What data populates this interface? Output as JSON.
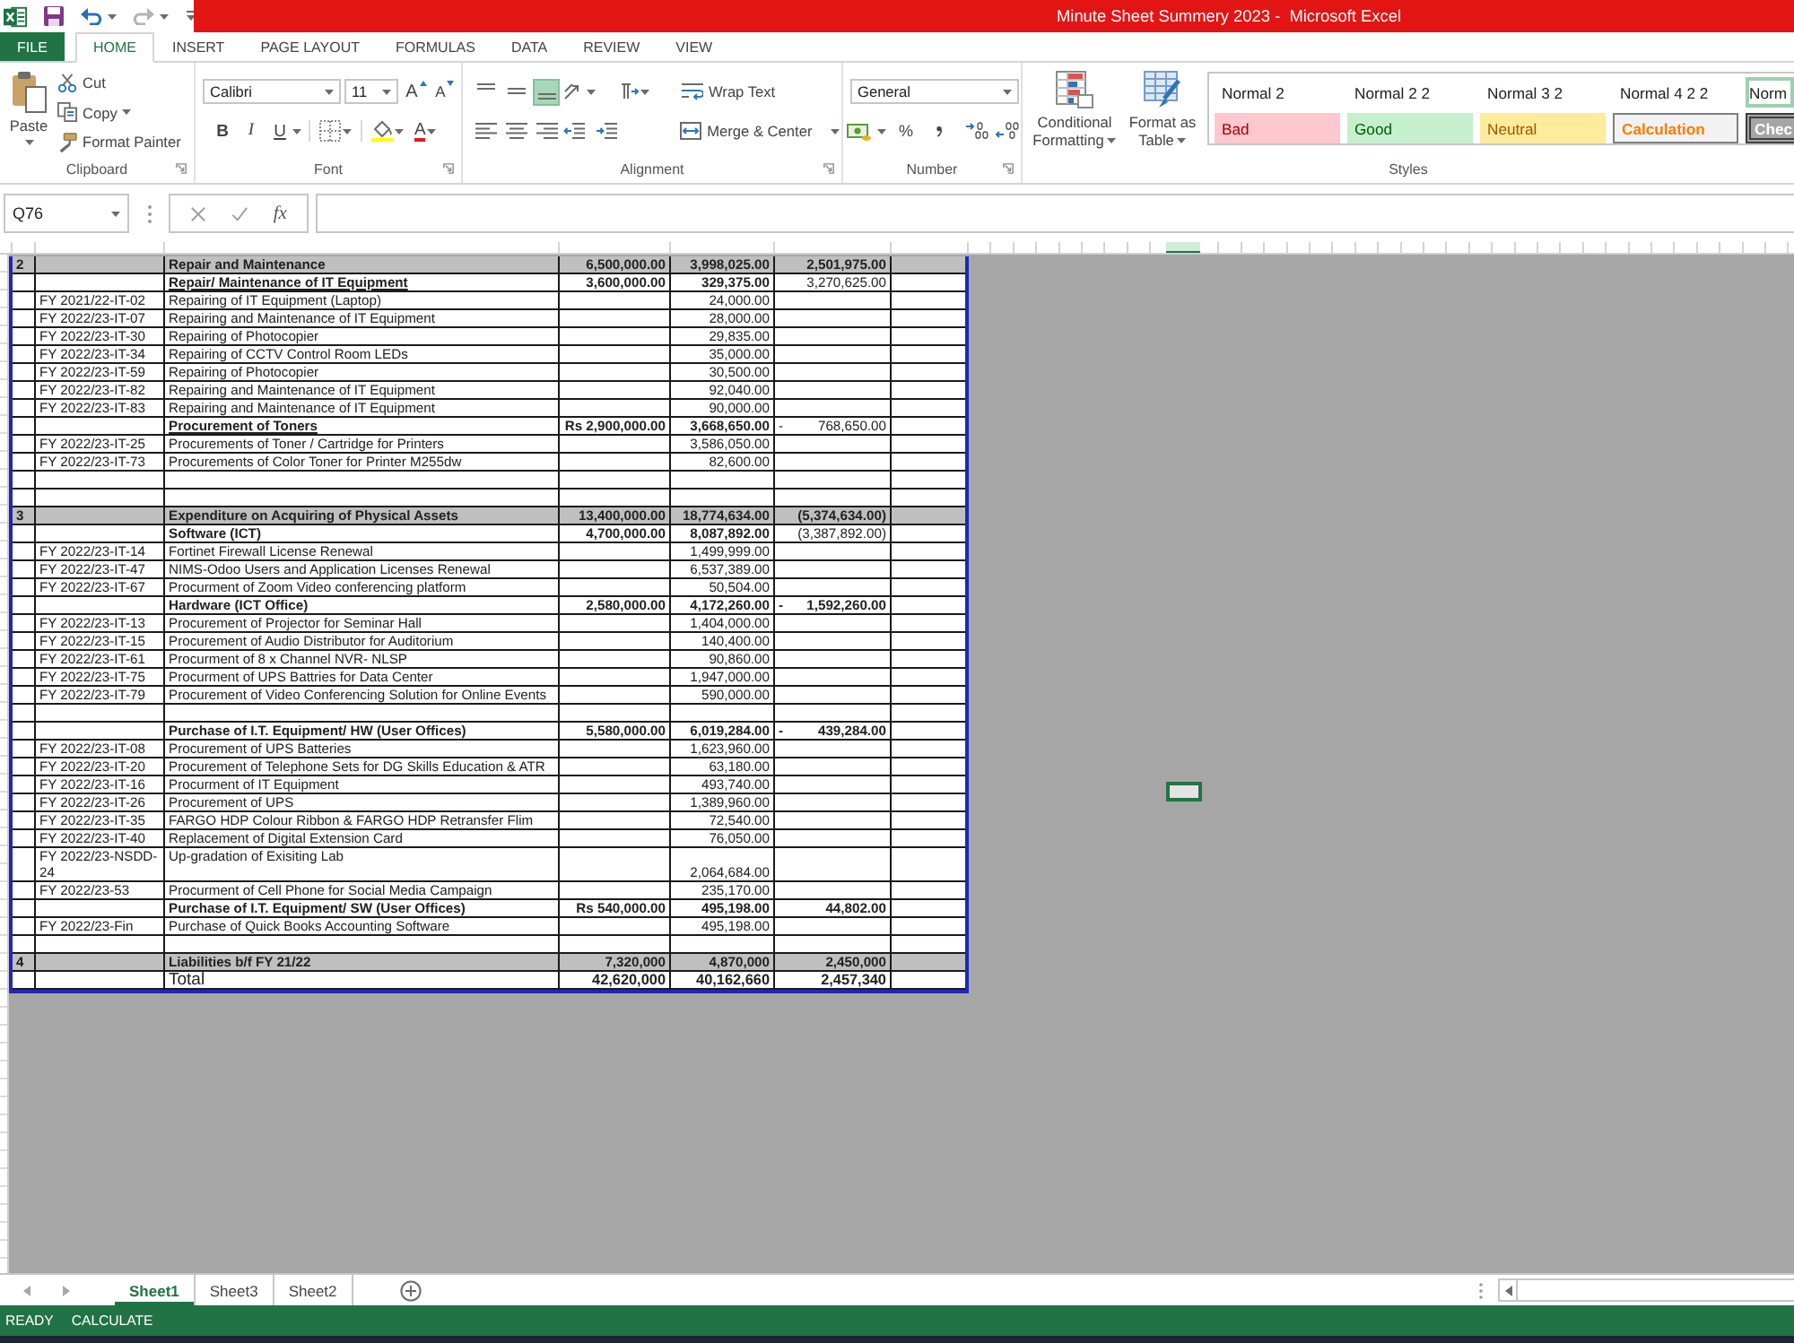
{
  "title_bar": {
    "title": "Minute Sheet Summery 2023 -  Microsoft Excel"
  },
  "ribbon_tabs": [
    {
      "label": "FILE",
      "kind": "file",
      "selected": false
    },
    {
      "label": "HOME",
      "kind": "tab",
      "selected": true
    },
    {
      "label": "INSERT",
      "kind": "tab",
      "selected": false
    },
    {
      "label": "PAGE LAYOUT",
      "kind": "tab",
      "selected": false
    },
    {
      "label": "FORMULAS",
      "kind": "tab",
      "selected": false
    },
    {
      "label": "DATA",
      "kind": "tab",
      "selected": false
    },
    {
      "label": "REVIEW",
      "kind": "tab",
      "selected": false
    },
    {
      "label": "VIEW",
      "kind": "tab",
      "selected": false
    }
  ],
  "ribbon": {
    "clipboard": {
      "label": "Clipboard",
      "paste": "Paste",
      "cut": "Cut",
      "copy": "Copy",
      "format_painter": "Format Painter"
    },
    "font": {
      "label": "Font",
      "font_name": "Calibri",
      "font_size": "11",
      "grow_font": "A",
      "shrink_font": "A",
      "bold": "B",
      "italic": "I",
      "underline": "U",
      "font_color": "A"
    },
    "alignment": {
      "label": "Alignment",
      "vertical_align": [
        {
          "selected": false
        },
        {
          "selected": false
        },
        {
          "selected": true
        }
      ],
      "wrap_text": "Wrap Text",
      "merge_center": "Merge & Center"
    },
    "number": {
      "label": "Number",
      "format": "General",
      "percent": "%"
    },
    "styles": {
      "label": "Styles",
      "conditional_formatting": "Conditional Formatting",
      "format_as_table": "Format as Table",
      "gallery": [
        {
          "label": "Normal 2",
          "kind": "plain",
          "selected": false
        },
        {
          "label": "Normal 2 2",
          "kind": "plain",
          "selected": false
        },
        {
          "label": "Normal 3 2",
          "kind": "plain",
          "selected": false
        },
        {
          "label": "Normal 4 2 2",
          "kind": "plain",
          "selected": false
        },
        {
          "label": "Norm",
          "kind": "plain",
          "selected": true
        },
        {
          "label": "Bad",
          "kind": "bad",
          "selected": false
        },
        {
          "label": "Good",
          "kind": "good",
          "selected": false
        },
        {
          "label": "Neutral",
          "kind": "neutral",
          "selected": false
        },
        {
          "label": "Calculation",
          "kind": "calculation",
          "selected": false
        },
        {
          "label": "Chec",
          "kind": "check",
          "selected": false
        }
      ]
    }
  },
  "formula_bar": {
    "name_box": "Q76",
    "function_button": "fx"
  },
  "sheet": {
    "rows": [
      {
        "kind": "section",
        "column_a": "2",
        "column_c": "Repair and Maintenance",
        "column_d": "6,500,000.00",
        "column_e": "3,998,025.00",
        "column_f": "2,501,975.00"
      },
      {
        "kind": "subhead",
        "underlined": true,
        "balance_bold": false,
        "column_c": "Repair/ Maintenance of IT Equipment",
        "column_d": "3,600,000.00",
        "column_e": "329,375.00",
        "column_f": "3,270,625.00"
      },
      {
        "kind": "item",
        "column_b": "FY 2021/22-IT-02",
        "column_c": "Repairing of IT Equipment (Laptop)",
        "column_e": "24,000.00"
      },
      {
        "kind": "item",
        "column_b": "FY 2022/23-IT-07",
        "column_c": "Repairing and Maintenance of IT Equipment",
        "column_e": "28,000.00"
      },
      {
        "kind": "item",
        "column_b": "FY 2022/23-IT-30",
        "column_c": "Repairing of Photocopier",
        "column_e": "29,835.00"
      },
      {
        "kind": "item",
        "column_b": "FY 2022/23-IT-34",
        "column_c": "Repairing of CCTV Control Room LEDs",
        "column_e": "35,000.00"
      },
      {
        "kind": "item",
        "column_b": "FY 2022/23-IT-59",
        "column_c": "Repairing of Photocopier",
        "column_e": "30,500.00"
      },
      {
        "kind": "item",
        "column_b": "FY 2022/23-IT-82",
        "column_c": "Repairing and Maintenance of IT Equipment",
        "column_e": "92,040.00"
      },
      {
        "kind": "item",
        "column_b": "FY 2022/23-IT-83",
        "column_c": "Repairing and Maintenance of IT Equipment",
        "column_e": "90,000.00"
      },
      {
        "kind": "subhead",
        "underlined": true,
        "balance_bold": false,
        "column_c": "Procurement of Toners",
        "column_d": "Rs 2,900,000.00",
        "column_e": "3,668,650.00",
        "column_f_sign": "-",
        "column_f": "768,650.00"
      },
      {
        "kind": "item",
        "column_b": "FY 2022/23-IT-25",
        "column_c": "Procurements of Toner / Cartridge for Printers",
        "column_e": "3,586,050.00"
      },
      {
        "kind": "item",
        "column_b": "FY 2022/23-IT-73",
        "column_c": "Procurements of Color Toner for Printer M255dw",
        "column_e": "82,600.00"
      },
      {
        "kind": "blank"
      },
      {
        "kind": "blank"
      },
      {
        "kind": "section",
        "column_a": "3",
        "column_c": "Expenditure on Acquiring of Physical Assets",
        "column_d": "13,400,000.00",
        "column_e": "18,774,634.00",
        "column_f": "(5,374,634.00)"
      },
      {
        "kind": "subhead",
        "underlined": false,
        "balance_bold": false,
        "column_c": "Software (ICT)",
        "column_d": "4,700,000.00",
        "column_e": "8,087,892.00",
        "column_f": "(3,387,892.00)"
      },
      {
        "kind": "item",
        "column_b": "FY 2022/23-IT-14",
        "column_c": "Fortinet Firewall License Renewal",
        "column_e": "1,499,999.00"
      },
      {
        "kind": "item",
        "column_b": "FY 2022/23-IT-47",
        "column_c": "NIMS-Odoo Users and Application Licenses Renewal",
        "column_e": "6,537,389.00"
      },
      {
        "kind": "item",
        "column_b": "FY 2022/23-IT-67",
        "column_c": "Procurment of Zoom Video conferencing platform",
        "column_e": "50,504.00"
      },
      {
        "kind": "subhead",
        "underlined": false,
        "balance_bold": true,
        "column_c": "Hardware (ICT Office)",
        "column_d": "2,580,000.00",
        "column_e": "4,172,260.00",
        "column_f_sign": "-",
        "column_f": "1,592,260.00"
      },
      {
        "kind": "item",
        "column_b": "FY 2022/23-IT-13",
        "column_c": "Procurement of Projector for Seminar Hall",
        "column_e": "1,404,000.00"
      },
      {
        "kind": "item",
        "column_b": "FY 2022/23-IT-15",
        "column_c": "Procurement of Audio Distributor for Auditorium",
        "column_e": "140,400.00"
      },
      {
        "kind": "item",
        "column_b": "FY 2022/23-IT-61",
        "column_c": "Procurment of 8 x Channel NVR- NLSP",
        "column_e": "90,860.00"
      },
      {
        "kind": "item",
        "column_b": "FY 2022/23-IT-75",
        "column_c": "Procurment of UPS Battries for Data Center",
        "column_e": "1,947,000.00"
      },
      {
        "kind": "item",
        "column_b": "FY 2022/23-IT-79",
        "column_c": "Procurement of Video Conferencing Solution for Online Events",
        "column_e": "590,000.00"
      },
      {
        "kind": "blank"
      },
      {
        "kind": "subhead",
        "underlined": false,
        "balance_bold": true,
        "column_c": "Purchase of I.T. Equipment/ HW (User Offices)",
        "column_d": "5,580,000.00",
        "column_e": "6,019,284.00",
        "column_f_sign": "-",
        "column_f": "439,284.00"
      },
      {
        "kind": "item",
        "column_b": "FY 2022/23-IT-08",
        "column_c": "Procurement of UPS Batteries",
        "column_e": "1,623,960.00"
      },
      {
        "kind": "item",
        "column_b": "FY 2022/23-IT-20",
        "column_c": "Procurement of Telephone Sets for DG Skills Education & ATR",
        "column_e": "63,180.00"
      },
      {
        "kind": "item",
        "column_b": "FY 2022/23-IT-16",
        "column_c": "Procurment of IT Equipment",
        "column_e": "493,740.00"
      },
      {
        "kind": "item",
        "column_b": "FY 2022/23-IT-26",
        "column_c": "Procurement of UPS",
        "column_e": "1,389,960.00"
      },
      {
        "kind": "item",
        "column_b": "FY 2022/23-IT-35",
        "column_c": "FARGO HDP Colour Ribbon & FARGO HDP Retransfer Flim",
        "column_e": "72,540.00"
      },
      {
        "kind": "item",
        "column_b": "FY 2022/23-IT-40",
        "column_c": "Replacement of Digital Extension Card",
        "column_e": "76,050.00"
      },
      {
        "kind": "item",
        "column_b": "FY 2022/23-NSDD-24",
        "column_c": "Up-gradation of Exisiting Lab",
        "column_e": "2,064,684.00"
      },
      {
        "kind": "item",
        "column_b": "FY 2022/23-53",
        "column_c": "Procurment of Cell Phone for Social Media Campaign",
        "column_e": "235,170.00"
      },
      {
        "kind": "subhead",
        "underlined": false,
        "balance_bold": true,
        "column_c": "Purchase of I.T. Equipment/ SW (User Offices)",
        "column_d": "Rs 540,000.00",
        "column_e": "495,198.00",
        "column_f": "44,802.00"
      },
      {
        "kind": "item",
        "column_b": "FY 2022/23-Fin",
        "column_c": "Purchase of Quick Books Accounting Software",
        "column_e": "495,198.00"
      },
      {
        "kind": "blank"
      },
      {
        "kind": "section",
        "column_a": "4",
        "column_c": "Liabilities b/f FY 21/22",
        "column_d": "7,320,000",
        "column_e": "4,870,000",
        "column_f": "2,450,000"
      },
      {
        "kind": "total",
        "column_c": "Total",
        "column_d": "42,620,000",
        "column_e": "40,162,660",
        "column_f": "2,457,340"
      }
    ]
  },
  "sheet_tabs": [
    {
      "label": "Sheet1",
      "selected": true
    },
    {
      "label": "Sheet3",
      "selected": false
    },
    {
      "label": "Sheet2",
      "selected": false
    }
  ],
  "status_bar": {
    "items": [
      "READY",
      "CALCULATE"
    ]
  }
}
